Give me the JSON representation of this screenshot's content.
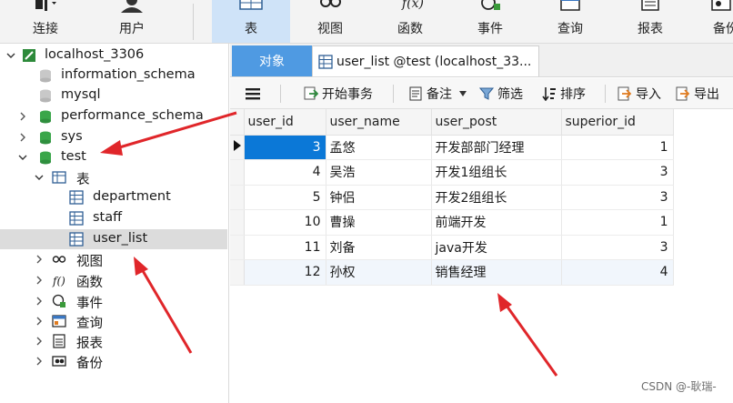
{
  "toolbar": {
    "buttons": [
      {
        "label": "连接",
        "icon": "connect-icon"
      },
      {
        "label": "用户",
        "icon": "user-icon"
      },
      {
        "label": "表",
        "icon": "table-icon",
        "active": true
      },
      {
        "label": "视图",
        "icon": "view-icon"
      },
      {
        "label": "函数",
        "icon": "function-icon"
      },
      {
        "label": "事件",
        "icon": "event-icon"
      },
      {
        "label": "查询",
        "icon": "query-icon"
      },
      {
        "label": "报表",
        "icon": "report-icon"
      },
      {
        "label": "备份",
        "icon": "backup-icon"
      }
    ],
    "active_bg": "#cfe3f8"
  },
  "navigator": {
    "connection": "localhost_3306",
    "databases": [
      "information_schema",
      "mysql",
      "performance_schema",
      "sys",
      "test"
    ],
    "test_children": {
      "tables_group": "表",
      "tables": [
        "department",
        "staff",
        "user_list"
      ],
      "groups": [
        "视图",
        "函数",
        "事件",
        "查询",
        "报表",
        "备份"
      ]
    },
    "selected": "user_list"
  },
  "tabs": {
    "objects": "对象",
    "table": "user_list @test (localhost_33..."
  },
  "subtoolbar": {
    "begin_transaction": "开始事务",
    "memo": "备注",
    "filter": "筛选",
    "sort": "排序",
    "import": "导入",
    "export": "导出"
  },
  "grid": {
    "columns": [
      "user_id",
      "user_name",
      "user_post",
      "superior_id"
    ],
    "rows": [
      [
        "3",
        "孟悠",
        "开发部部门经理",
        "1"
      ],
      [
        "4",
        "吴浩",
        "开发1组组长",
        "3"
      ],
      [
        "5",
        "钟侣",
        "开发2组组长",
        "3"
      ],
      [
        "10",
        "曹操",
        "前端开发",
        "1"
      ],
      [
        "11",
        "刘备",
        "java开发",
        "3"
      ],
      [
        "12",
        "孙权",
        "销售经理",
        "4"
      ]
    ],
    "selection_color": "#0b78d7"
  },
  "annotation": {
    "arrow_color": "#e0262a"
  },
  "watermark": "CSDN @-耿瑞-"
}
